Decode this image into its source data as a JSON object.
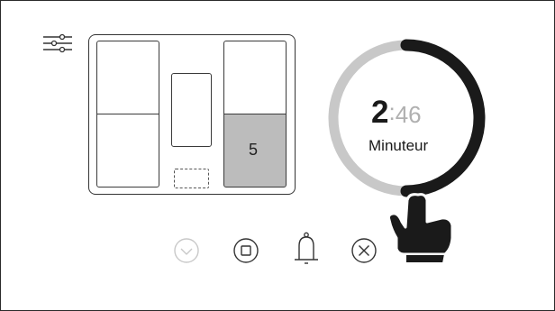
{
  "timer": {
    "minutes": "2",
    "separator": ":",
    "seconds": "46",
    "label": "Minuteur",
    "progress_fraction": 0.5
  },
  "cooktop": {
    "active_zone_level": "5"
  },
  "controls": {
    "icons": [
      "clock-icon",
      "stop-icon",
      "bell-icon",
      "close-icon"
    ]
  },
  "colors": {
    "ring_active": "#1a1a1a",
    "ring_inactive": "#c8c8c8",
    "zone_fill_active": "#bcbcbc",
    "seconds_text": "#b0b0b0",
    "disabled_icon": "#c8c8c8"
  }
}
